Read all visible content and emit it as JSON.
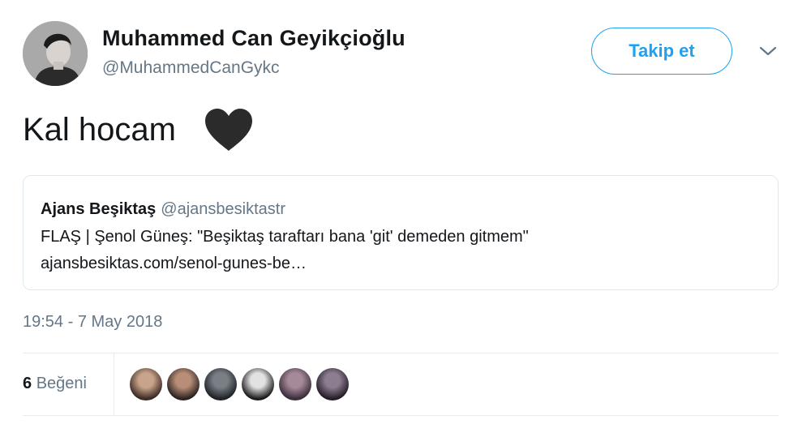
{
  "author": {
    "name": "Muhammed Can Geyikçioğlu",
    "handle": "@MuhammedCanGykc"
  },
  "follow_button": {
    "label": "Takip et"
  },
  "colors": {
    "accent": "#1da1f2",
    "muted": "#657786",
    "text": "#14171a",
    "border": "#e1e8ed"
  },
  "tweet": {
    "text": "Kal hocam",
    "emoji": "black-heart-icon"
  },
  "quoted_tweet": {
    "name": "Ajans Beşiktaş",
    "handle": "@ajansbesiktastr",
    "text": "FLAŞ | Şenol Güneş: \"Beşiktaş taraftarı bana 'git' demeden gitmem\"",
    "link": "ajansbesiktas.com/senol-gunes-be…"
  },
  "timestamp": "19:54 - 7 May 2018",
  "likes": {
    "count": "6",
    "label": "Beğeni"
  },
  "likers": [
    {
      "name": "liker-avatar-1",
      "colors": [
        "#c9a48c",
        "#3b2a24"
      ]
    },
    {
      "name": "liker-avatar-2",
      "colors": [
        "#b98e78",
        "#2a2220"
      ]
    },
    {
      "name": "liker-avatar-3",
      "colors": [
        "#7a7f86",
        "#1e2226"
      ]
    },
    {
      "name": "liker-avatar-4",
      "colors": [
        "#e2e2e2",
        "#1a1a1a"
      ]
    },
    {
      "name": "liker-avatar-5",
      "colors": [
        "#a78a9a",
        "#3a2d3a"
      ]
    },
    {
      "name": "liker-avatar-6",
      "colors": [
        "#8d7d90",
        "#231c28"
      ]
    }
  ]
}
